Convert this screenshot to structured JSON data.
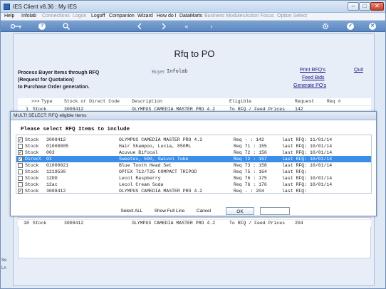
{
  "window": {
    "title": "IES Client v8.36 : My IES",
    "min": "–",
    "max": "□",
    "close": "✕"
  },
  "menu": [
    {
      "label": "Help",
      "dim": false
    },
    {
      "label": "Infolab",
      "dim": false
    },
    {
      "label": "Connections",
      "dim": true
    },
    {
      "label": "Logon",
      "dim": true
    },
    {
      "label": "Logoff",
      "dim": false
    },
    {
      "label": "Companion",
      "dim": false
    },
    {
      "label": "Wizard",
      "dim": false
    },
    {
      "label": "How do I",
      "dim": false
    },
    {
      "label": "DataMarts",
      "dim": false
    },
    {
      "label": "Business Modules",
      "dim": true
    },
    {
      "label": "Action Focus",
      "dim": true
    },
    {
      "label": "Option Select",
      "dim": true
    }
  ],
  "toolbar": {
    "icons": [
      "key-icon",
      "help-icon",
      "search-icon",
      "back-icon",
      "forward-icon",
      "rewind-icon",
      "play-icon",
      "gear-icon",
      "check-icon",
      "close-icon"
    ],
    "help_glyph": "?",
    "rewind_glyph": "«",
    "play_glyph": "›",
    "check_glyph": "✓",
    "close_glyph": "✕"
  },
  "main": {
    "title": "Rfq to PO",
    "description": [
      "Process Buyer Items through RFQ",
      "(Request for Quotation)",
      "to Purchase Order generation."
    ],
    "buyer_label": "Buyer",
    "buyer_value": "Infolab",
    "links": {
      "print": "Print RFQ's",
      "feed": "Feed Bids",
      "generate": "Generate PO's",
      "quit": "Quit"
    },
    "grid_headers": {
      "arrows": ">>>",
      "type": "Type",
      "stock": "Stock or Direct Code",
      "description": "Description",
      "eligible": "Eligible",
      "request": "Request",
      "req_no": "Req #"
    },
    "grid_rows": [
      {
        "num": "1",
        "type": "Stock",
        "code": "3008412",
        "description": "OLYMPUS CAMEDIA MASTER PRO 4.2",
        "eligible": "To RFQ / Feed Prices",
        "request": "142"
      },
      {
        "num": "18",
        "type": "Stock",
        "code": "3008412",
        "description": "OLYMPUS CAMEDIA MASTER PRO 4.2",
        "eligible": "To RFQ / Feed Prices",
        "request": "204"
      }
    ],
    "left_stub": [
      "Se",
      "Ln"
    ]
  },
  "modal": {
    "title": "MULTI SELECT: RFQ eligible Items",
    "heading": "Please select RFQ Items to include",
    "rows": [
      {
        "checked": true,
        "type": "Stock",
        "code": "3008412",
        "description": "OLYMPUS CAMEDIA MASTER PRO 4.2",
        "req": "Req - : 142",
        "last": "last RFQ: 11/01/14",
        "selected": false
      },
      {
        "checked": false,
        "type": "Stock",
        "code": "01000005",
        "description": "Hair Shampoo, Lucia, 850ML",
        "req": "Req 71 : 155",
        "last": "last RFQ: 10/01/14",
        "selected": false
      },
      {
        "checked": true,
        "type": "Stock",
        "code": "003",
        "description": "Acuvue Bifocal",
        "req": "Req 72 : 156",
        "last": "last RFQ: 10/01/14",
        "selected": false
      },
      {
        "checked": true,
        "type": "Direct",
        "code": "01",
        "description": "Sweetex, 500, Swivel Tube",
        "req": "Req 72 : 157",
        "last": "last RFQ: 10/01/14",
        "selected": true
      },
      {
        "checked": false,
        "type": "Stock",
        "code": "01000021",
        "description": "Blue Tooth Head Set",
        "req": "Req 73 : 158",
        "last": "last RFQ: 10/01/14",
        "selected": false
      },
      {
        "checked": false,
        "type": "Stock",
        "code": "1219530",
        "description": "OPTEX T12/T25 COMPACT TRIPOD",
        "req": "Req 75 : 164",
        "last": "last RFQ:",
        "selected": false
      },
      {
        "checked": false,
        "type": "Stock",
        "code": "12DD",
        "description": "Lecol Raspberry",
        "req": "Req 76 : 175",
        "last": "last RFQ: 10/01/14",
        "selected": false
      },
      {
        "checked": false,
        "type": "Stock",
        "code": "12ac",
        "description": "Lecol Cream Soda",
        "req": "Req 76 : 176",
        "last": "last RFQ: 10/01/14",
        "selected": false
      },
      {
        "checked": true,
        "type": "Stock",
        "code": "3008412",
        "description": "OLYMPUS CAMEDIA MASTER PRO 4.2",
        "req": "Req - : 204",
        "last": "last RFQ:",
        "selected": false
      }
    ],
    "check_glyph": "✓",
    "buttons": {
      "select_all": "Select ALL",
      "show_full_line": "Show Full Line",
      "cancel": "Cancel",
      "ok": "OK"
    }
  }
}
